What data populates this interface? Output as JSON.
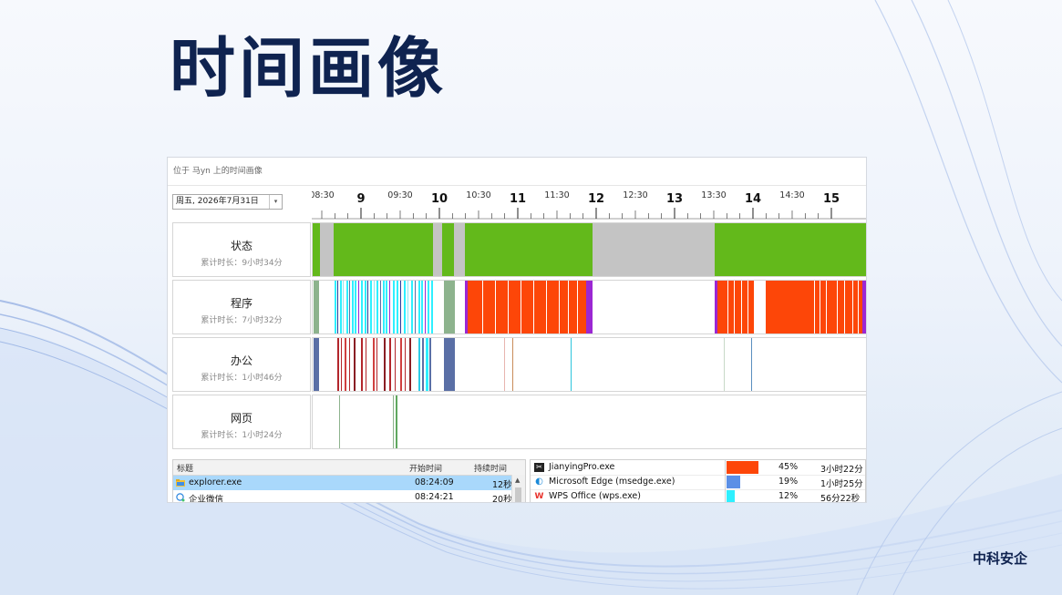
{
  "slide": {
    "title": "时间画像",
    "brand": "中科安企"
  },
  "window": {
    "caption": "位于 马yn 上的时间画像"
  },
  "date_picker": {
    "value": "周五, 2026年7月31日",
    "arrow": "▾"
  },
  "ruler": {
    "major": [
      "9",
      "10",
      "11",
      "12",
      "13",
      "14",
      "15"
    ],
    "minor": [
      "08:30",
      "09:30",
      "10:30",
      "11:30",
      "12:30",
      "13:30",
      "14:30",
      "15"
    ]
  },
  "rows": [
    {
      "name": "状态",
      "sub": "累计时长：9小时34分"
    },
    {
      "name": "程序",
      "sub": "累计时长：7小时32分"
    },
    {
      "name": "办公",
      "sub": "累计时长：1小时46分"
    },
    {
      "name": "网页",
      "sub": "累计时长：1小时24分"
    }
  ],
  "colors": {
    "active": "#63b91b",
    "idle": "#c4c4c4",
    "program_red": "#fd4608",
    "purple": "#9b27d3",
    "cyan": "#2ef0ff",
    "green_gray": "#8db38d",
    "navy": "#5a6fa6",
    "maroon": "#b3262c"
  },
  "event_list": {
    "columns": [
      "标题",
      "开始时间",
      "持续时间"
    ],
    "rows": [
      {
        "icon": "folder-icon",
        "title": "explorer.exe",
        "start": "08:24:09",
        "duration": "12秒",
        "selected": true
      },
      {
        "icon": "wecom-icon",
        "title": "企业微信",
        "start": "08:24:21",
        "duration": "20秒",
        "selected": false
      }
    ],
    "scroll_up": "▲"
  },
  "app_usage": [
    {
      "icon": "jianying-icon",
      "name": "JianyingPro.exe",
      "percent": "45%",
      "duration": "3小时22分",
      "color": "#fd4608",
      "share": 0.45
    },
    {
      "icon": "edge-icon",
      "name": "Microsoft Edge (msedge.exe)",
      "percent": "19%",
      "duration": "1小时25分",
      "color": "#5b8fe6",
      "share": 0.19
    },
    {
      "icon": "wps-icon",
      "name": "WPS Office (wps.exe)",
      "percent": "12%",
      "duration": "56分22秒",
      "color": "#2ef0ff",
      "share": 0.12
    }
  ]
}
